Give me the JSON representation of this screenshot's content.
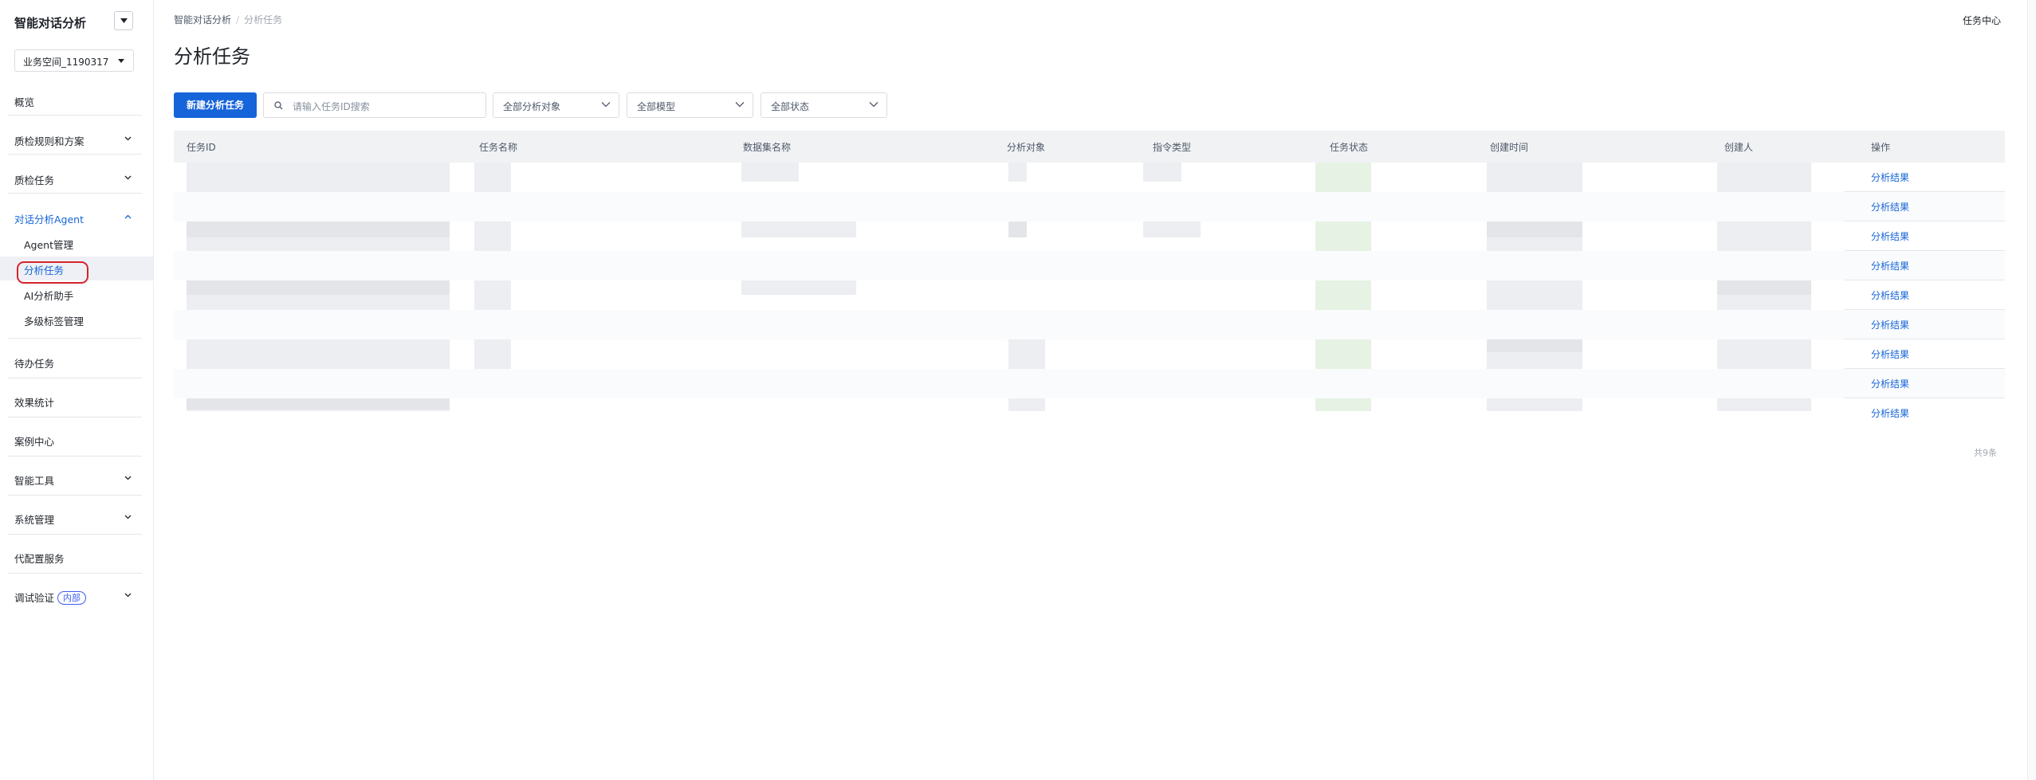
{
  "sidebar": {
    "app_title": "智能对话分析",
    "workspace": "业务空间_1190317",
    "items": [
      {
        "label": "概览"
      },
      {
        "label": "质检规则和方案"
      },
      {
        "label": "质检任务"
      },
      {
        "label": "对话分析Agent"
      },
      {
        "label": "Agent管理"
      },
      {
        "label": "分析任务"
      },
      {
        "label": "AI分析助手"
      },
      {
        "label": "多级标签管理"
      },
      {
        "label": "待办任务"
      },
      {
        "label": "效果统计"
      },
      {
        "label": "案例中心"
      },
      {
        "label": "智能工具"
      },
      {
        "label": "系统管理"
      },
      {
        "label": "代配置服务"
      },
      {
        "label": "调试验证"
      }
    ],
    "debug_badge": "内部"
  },
  "header": {
    "breadcrumb_root": "智能对话分析",
    "breadcrumb_sep": "/",
    "breadcrumb_current": "分析任务",
    "task_center": "任务中心",
    "page_title": "分析任务"
  },
  "toolbar": {
    "new_task_label": "新建分析任务",
    "search_placeholder": "请输入任务ID搜索",
    "filter_target": "全部分析对象",
    "filter_model": "全部模型",
    "filter_status": "全部状态"
  },
  "table": {
    "columns": [
      "任务ID",
      "任务名称",
      "数据集名称",
      "分析对象",
      "指令类型",
      "任务状态",
      "创建时间",
      "创建人",
      "操作"
    ],
    "rows": [
      {
        "action": "分析结果"
      },
      {
        "action": "分析结果"
      },
      {
        "action": "分析结果"
      },
      {
        "action": "分析结果"
      },
      {
        "action": "分析结果"
      },
      {
        "action": "分析结果"
      },
      {
        "action": "分析结果"
      },
      {
        "action": "分析结果"
      },
      {
        "action": "分析结果"
      }
    ],
    "total": "共9条"
  },
  "colors": {
    "primary": "#1664d9",
    "highlight_ring": "#d6232c",
    "badge": "#3d5cf5"
  }
}
